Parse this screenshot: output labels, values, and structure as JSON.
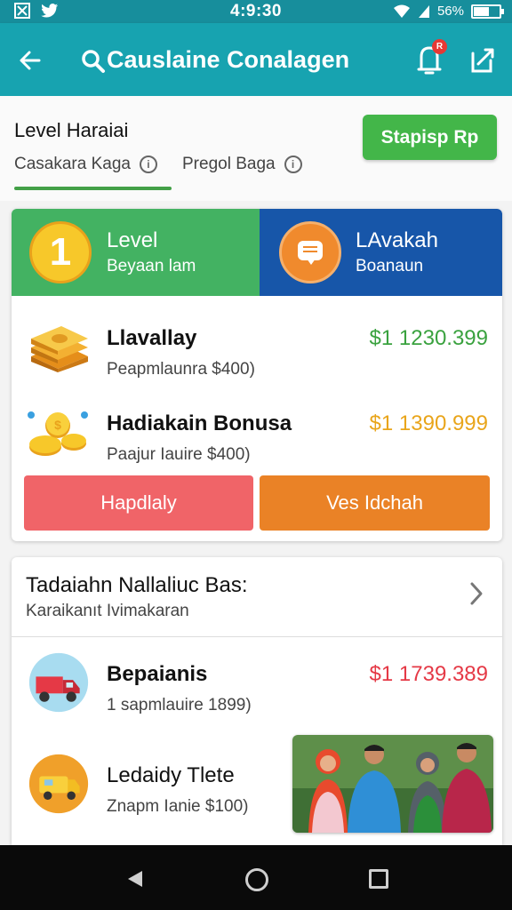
{
  "status_bar": {
    "time": "4:9:30",
    "battery": "56%",
    "battery_level": 0.56
  },
  "app_bar": {
    "title": "Causlaine Conalagen",
    "notification_badge": "R"
  },
  "level_header": {
    "title": "Level Haraiai",
    "tabs": [
      {
        "label": "Casakara Kaga",
        "active": true
      },
      {
        "label": "Pregol Baga",
        "active": false
      }
    ],
    "action_button": "Stapisp Rp"
  },
  "level_card": {
    "banner_left": {
      "badge": "1",
      "title": "Level",
      "subtitle": "Beyaan lam"
    },
    "banner_right": {
      "title": "LAvakah",
      "subtitle": "Boanaun"
    },
    "rewards": [
      {
        "name": "Llavallay",
        "subtitle": "Peapmlaunra $400)",
        "amount": "$1 1230.399",
        "icon": "money-stack-icon"
      },
      {
        "name": "Hadiakain Bonusa",
        "subtitle": "Paajur Iauire $400)",
        "amount": "$1 1390.999",
        "icon": "gold-coins-icon"
      }
    ],
    "buttons": {
      "left": "Hapdlaly",
      "right": "Ves Idchah"
    }
  },
  "list_card": {
    "title": "Tadaiahn Nallaliuc Bas:",
    "subtitle": "Karaikanıt Ivimakaran",
    "items": [
      {
        "name": "Bepaianis",
        "subtitle": "1 sapmlauire 1899)",
        "amount": "$1 1739.389",
        "icon": "red-truck-icon"
      },
      {
        "name": "Ledaidy Tlete",
        "subtitle": "Znapm Ianie $100)",
        "icon": "yellow-van-icon"
      }
    ]
  },
  "colors": {
    "app_bar": "#17a3b0",
    "level_green": "#43b262",
    "lavakah_blue": "#1756a9",
    "button_red": "#f06468",
    "button_orange": "#ea8226",
    "amount_green": "#3aa23f",
    "amount_gold": "#e9a51b",
    "amount_red": "#e53946"
  }
}
